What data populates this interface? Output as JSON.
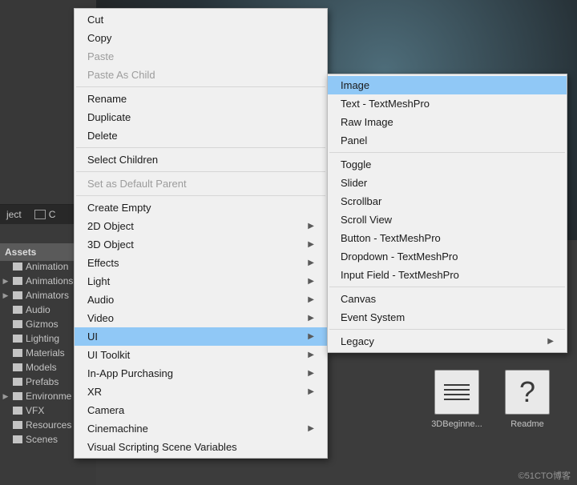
{
  "tabs": {
    "project_label": "ject",
    "console_icon_label": "C"
  },
  "assets": {
    "header": "Assets",
    "items": [
      {
        "label": "Animation",
        "tri": ""
      },
      {
        "label": "Animations",
        "tri": "▶"
      },
      {
        "label": "Animators",
        "tri": "▶"
      },
      {
        "label": "Audio",
        "tri": ""
      },
      {
        "label": "Gizmos",
        "tri": ""
      },
      {
        "label": "Lighting",
        "tri": ""
      },
      {
        "label": "Materials",
        "tri": ""
      },
      {
        "label": "Models",
        "tri": ""
      },
      {
        "label": "Prefabs",
        "tri": ""
      },
      {
        "label": "Environme",
        "tri": "▶"
      },
      {
        "label": "VFX",
        "tri": ""
      },
      {
        "label": "Resources",
        "tri": ""
      },
      {
        "label": "Scenes",
        "tri": ""
      }
    ]
  },
  "thumbs": [
    {
      "label": "3DBeginne...",
      "type": "doc"
    },
    {
      "label": "Readme",
      "type": "question"
    }
  ],
  "watermark": "©51CTO博客",
  "context_menu": {
    "groups": [
      [
        {
          "label": "Cut"
        },
        {
          "label": "Copy"
        },
        {
          "label": "Paste",
          "disabled": true
        },
        {
          "label": "Paste As Child",
          "disabled": true
        }
      ],
      [
        {
          "label": "Rename"
        },
        {
          "label": "Duplicate"
        },
        {
          "label": "Delete"
        }
      ],
      [
        {
          "label": "Select Children"
        }
      ],
      [
        {
          "label": "Set as Default Parent",
          "disabled": true
        }
      ],
      [
        {
          "label": "Create Empty"
        },
        {
          "label": "2D Object",
          "submenu": true
        },
        {
          "label": "3D Object",
          "submenu": true
        },
        {
          "label": "Effects",
          "submenu": true
        },
        {
          "label": "Light",
          "submenu": true
        },
        {
          "label": "Audio",
          "submenu": true
        },
        {
          "label": "Video",
          "submenu": true
        },
        {
          "label": "UI",
          "submenu": true,
          "highlight": true
        },
        {
          "label": "UI Toolkit",
          "submenu": true
        },
        {
          "label": "In-App Purchasing",
          "submenu": true
        },
        {
          "label": "XR",
          "submenu": true
        },
        {
          "label": "Camera"
        },
        {
          "label": "Cinemachine",
          "submenu": true
        },
        {
          "label": "Visual Scripting Scene Variables"
        }
      ]
    ]
  },
  "submenu": {
    "groups": [
      [
        {
          "label": "Image",
          "highlight": true
        },
        {
          "label": "Text - TextMeshPro"
        },
        {
          "label": "Raw Image"
        },
        {
          "label": "Panel"
        }
      ],
      [
        {
          "label": "Toggle"
        },
        {
          "label": "Slider"
        },
        {
          "label": "Scrollbar"
        },
        {
          "label": "Scroll View"
        },
        {
          "label": "Button - TextMeshPro"
        },
        {
          "label": "Dropdown - TextMeshPro"
        },
        {
          "label": "Input Field - TextMeshPro"
        }
      ],
      [
        {
          "label": "Canvas"
        },
        {
          "label": "Event System"
        }
      ],
      [
        {
          "label": "Legacy",
          "submenu": true
        }
      ]
    ]
  }
}
